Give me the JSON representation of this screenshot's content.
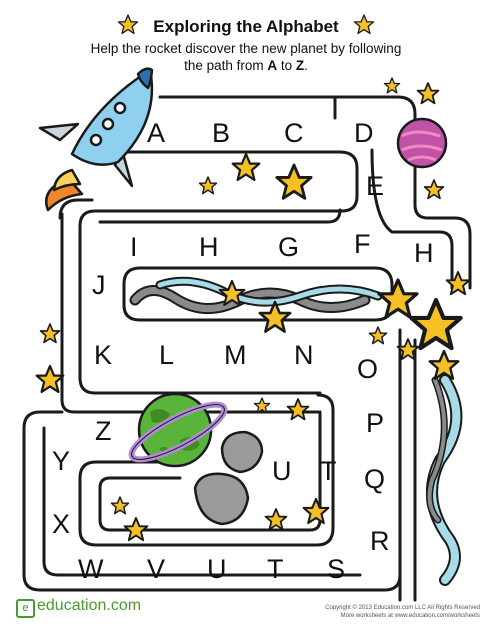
{
  "title": "Exploring the Alphabet",
  "subtitle_pre": "Help the rocket discover the new planet by following",
  "subtitle_mid": "the path from ",
  "subtitle_a": "A",
  "subtitle_to": " to ",
  "subtitle_z": "Z",
  "subtitle_end": ".",
  "letters": [
    "A",
    "B",
    "C",
    "D",
    "E",
    "F",
    "G",
    "H",
    "I",
    "H",
    "J",
    "K",
    "L",
    "M",
    "N",
    "O",
    "P",
    "Q",
    "R",
    "S",
    "T",
    "U",
    "V",
    "W",
    "X",
    "Y",
    "Z",
    "U",
    "T"
  ],
  "footer": {
    "logo": "education.com",
    "copyright": "Copyright © 2013 Education.com LLC All Rights Reserved",
    "more": "More worksheets at www.education.com/worksheets"
  },
  "colors": {
    "path": "#1a1a1a",
    "star": "#f5c024",
    "planet_pink": "#c052a8",
    "planet_green": "#5bb43a",
    "ring": "#b28ad8",
    "rocket_body": "#8fd0ef",
    "rocket_fire": "#f0862a",
    "ribbon": "#a8dbe8",
    "rock": "#9a9a9a",
    "logo": "#4a9b2e"
  }
}
